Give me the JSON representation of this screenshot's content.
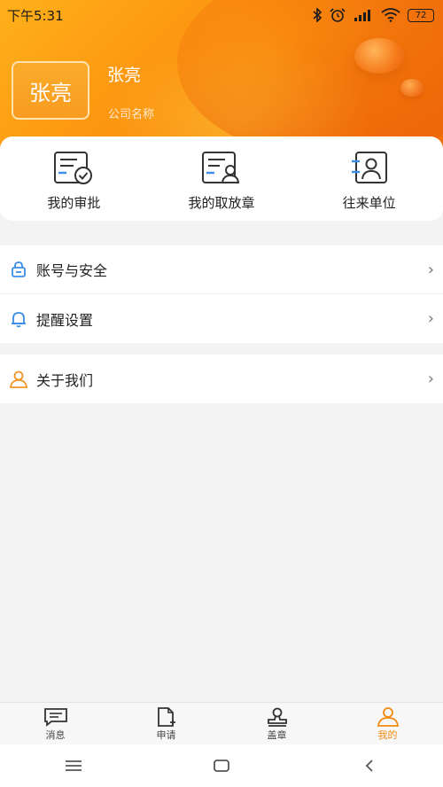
{
  "status_bar": {
    "time": "下午5:31",
    "battery": "72"
  },
  "profile": {
    "avatar_text": "张亮",
    "name": "张亮",
    "company": "公司名称"
  },
  "quick_actions": [
    {
      "label": "我的审批",
      "icon": "approval-icon"
    },
    {
      "label": "我的取放章",
      "icon": "seal-pickup-icon"
    },
    {
      "label": "往来单位",
      "icon": "contacts-icon"
    }
  ],
  "menu": {
    "group1": [
      {
        "label": "账号与安全",
        "icon": "lock-icon"
      },
      {
        "label": "提醒设置",
        "icon": "bell-icon"
      }
    ],
    "group2": [
      {
        "label": "关于我们",
        "icon": "person-icon"
      }
    ]
  },
  "tabbar": [
    {
      "label": "消息",
      "icon": "message-icon"
    },
    {
      "label": "申请",
      "icon": "apply-icon"
    },
    {
      "label": "盖章",
      "icon": "stamp-icon"
    },
    {
      "label": "我的",
      "icon": "user-icon",
      "active": true
    }
  ],
  "colors": {
    "accent": "#f08a12",
    "header_start": "#ffb01a",
    "header_end": "#f06d0a",
    "icon_blue": "#3a8ee6"
  }
}
